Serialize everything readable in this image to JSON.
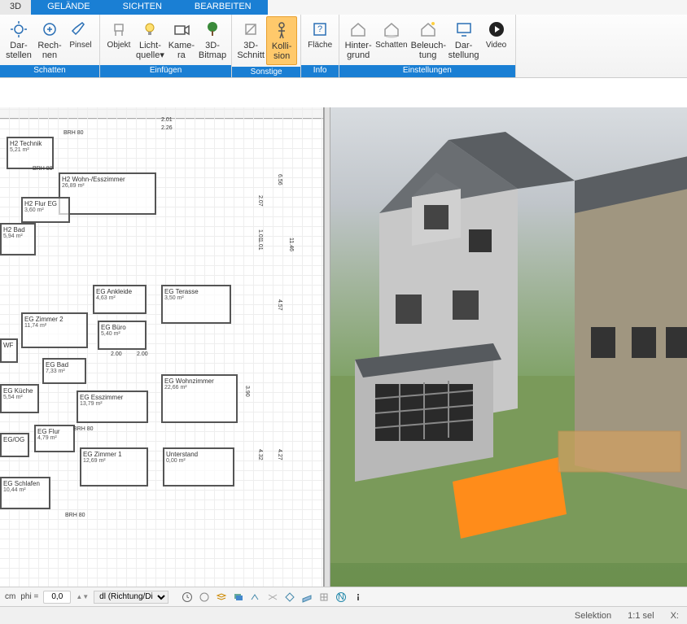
{
  "tabs": {
    "t1": "3D",
    "t2": "GELÄNDE",
    "t3": "SICHTEN",
    "t4": "BEARBEITEN"
  },
  "ribbon": {
    "g1": {
      "title": "Schatten",
      "b1": {
        "l1": "Dar-",
        "l2": "stellen"
      },
      "b2": {
        "l1": "Rech-",
        "l2": "nen"
      },
      "b3": {
        "l1": "Pinsel"
      }
    },
    "g2": {
      "title": "Einfügen",
      "b1": {
        "l1": "Objekt"
      },
      "b2": {
        "l1": "Licht-",
        "l2": "quelle▾"
      },
      "b3": {
        "l1": "Kame-",
        "l2": "ra"
      },
      "b4": {
        "l1": "3D-",
        "l2": "Bitmap"
      }
    },
    "g3": {
      "title": "Sonstige",
      "b1": {
        "l1": "3D-",
        "l2": "Schnitt"
      },
      "b2": {
        "l1": "Kolli-",
        "l2": "sion"
      }
    },
    "g4": {
      "title": "Info",
      "b1": {
        "l1": "Fläche"
      }
    },
    "g5": {
      "title": "Einstellungen",
      "b1": {
        "l1": "Hinter-",
        "l2": "grund"
      },
      "b2": {
        "l1": "Schatten"
      },
      "b3": {
        "l1": "Beleuch-",
        "l2": "tung"
      },
      "b4": {
        "l1": "Dar-",
        "l2": "stellung"
      },
      "b5": {
        "l1": "Video"
      }
    }
  },
  "rooms": {
    "h2_technik": {
      "name": "H2 Technik",
      "area": "5,21 m²"
    },
    "h2_wohn": {
      "name": "H2 Wohn-/Esszimmer",
      "area": "26,89 m²"
    },
    "h2_flur": {
      "name": "H2 Flur EG",
      "area": "3,60 m²"
    },
    "h2_bad": {
      "name": "H2 Bad",
      "area": "5,94 m²"
    },
    "eg_ankleide": {
      "name": "EG Ankleide",
      "area": "4,63 m²"
    },
    "eg_terasse": {
      "name": "EG Terasse",
      "area": "3,50 m²"
    },
    "eg_zimmer2": {
      "name": "EG Zimmer 2",
      "area": "11,74 m²"
    },
    "eg_buero": {
      "name": "EG Büro",
      "area": "5,40 m²"
    },
    "eg_bad": {
      "name": "EG Bad",
      "area": "7,33 m²"
    },
    "eg_wohn": {
      "name": "EG Wohnzimmer",
      "area": "22,66 m²"
    },
    "eg_kueche": {
      "name": "EG Küche",
      "area": "5,54 m²"
    },
    "eg_ess": {
      "name": "EG Esszimmer",
      "area": "13,79 m²"
    },
    "wf": {
      "name": "WF",
      "area": ""
    },
    "eg_flur": {
      "name": "EG Flur",
      "area": "4,79 m²"
    },
    "eg_og": {
      "name": "EG/OG",
      "area": ""
    },
    "eg_zimmer1": {
      "name": "EG Zimmer 1",
      "area": "12,69 m²"
    },
    "unterstand": {
      "name": "Unterstand",
      "area": "0,00 m²"
    },
    "eg_schlafen": {
      "name": "EG Schlafen",
      "area": "10,44 m²"
    }
  },
  "dims": {
    "d1": "2.01",
    "d2": "2.26",
    "d3": "2.07",
    "d4": "1.01",
    "d5": "1.01",
    "d6": "11.46",
    "d7": "6.56",
    "d8": "4.57",
    "d9": "3.90",
    "d10": "4.27",
    "d11": "4.32",
    "d12": "2.00",
    "d13": "2.00",
    "d14": "BRH 80",
    "d15": "BRH 80",
    "d16": "BRH 80",
    "d17": "BRH 80"
  },
  "status": {
    "unit": "cm",
    "phi": "phi =",
    "phi_val": "0,0",
    "dd": "dl (Richtung/Di"
  },
  "bottom": {
    "sel": "Selektion",
    "scale": "1:1 sel",
    "coord": "X:"
  }
}
